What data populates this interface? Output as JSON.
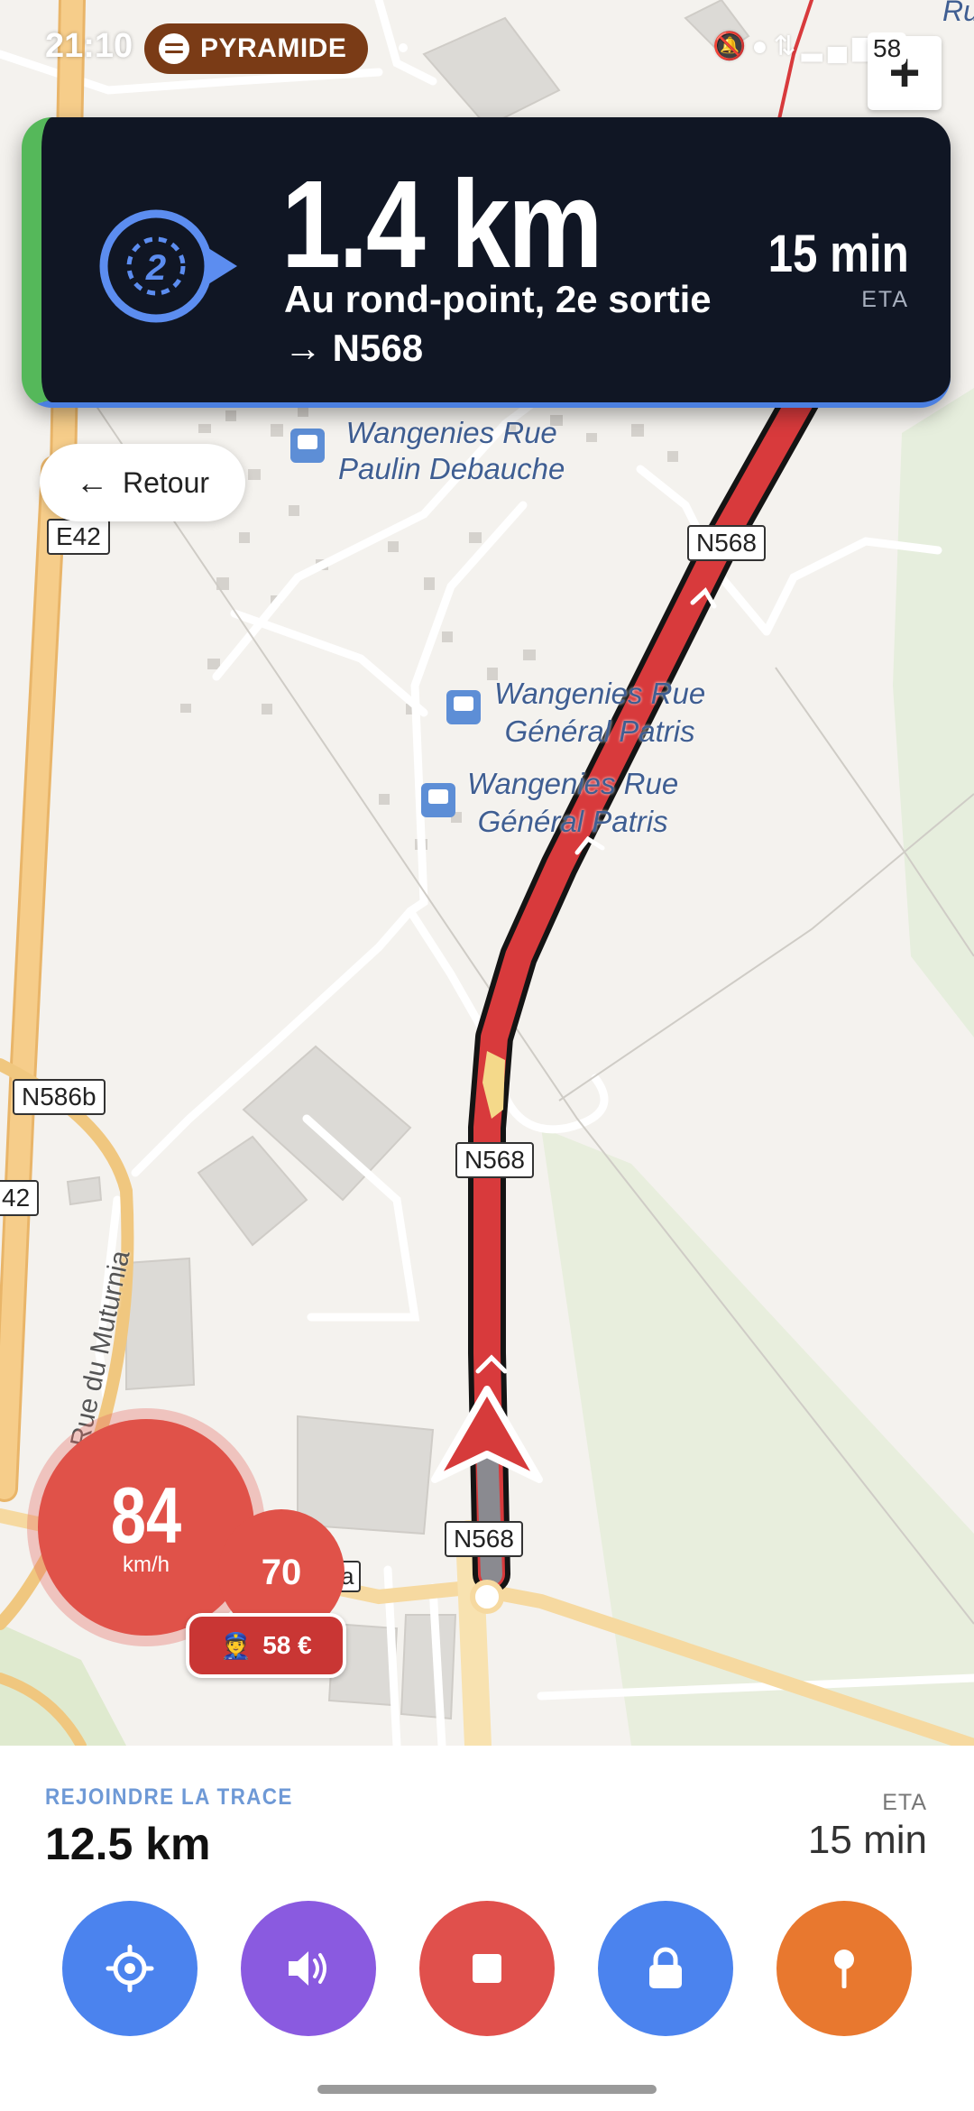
{
  "status_bar": {
    "time": "21:10",
    "music": "PYRAMIDE",
    "battery": "58",
    "icons": [
      "mute-icon",
      "location-icon",
      "data-icon",
      "signal-icon"
    ]
  },
  "map": {
    "labels": {
      "bus1_line1": "Wangenies Rue",
      "bus1_line2": "Paulin Debauche",
      "bus2_line1": "Wangenies Rue",
      "bus2_line2": "Général Patris",
      "bus3_line1": "Wangenies Rue",
      "bus3_line2": "Général Patris",
      "road_n568": "N568",
      "road_e42": "E42",
      "road_e42_partial": "42",
      "road_n586b": "N586b",
      "street_mutumia": "Rue du Muturnia",
      "partial_top": "Ru",
      "partial_small": "a"
    },
    "zoom_in": "+"
  },
  "navigation": {
    "distance": "1.4 km",
    "instruction_line1": "Au rond-point, 2e sortie",
    "instruction_line2": "→ N568",
    "eta_time": "15 min",
    "eta_label": "ETA",
    "roundabout_exit": "2"
  },
  "back_button": {
    "label": "Retour"
  },
  "speed": {
    "current": "84",
    "unit": "km/h",
    "limit": "70",
    "fine": "58 €"
  },
  "bottom": {
    "route_label": "REJOINDRE LA TRACE",
    "remaining_distance": "12.5 km",
    "eta_label": "ETA",
    "eta_value": "15 min"
  },
  "colors": {
    "route": "#d83a3c",
    "card_bg": "#101624",
    "recenter": "#4b83ee",
    "sound": "#8a5ae0",
    "stop": "#e0504c",
    "lock": "#4b83ee",
    "pin": "#e8782f"
  }
}
